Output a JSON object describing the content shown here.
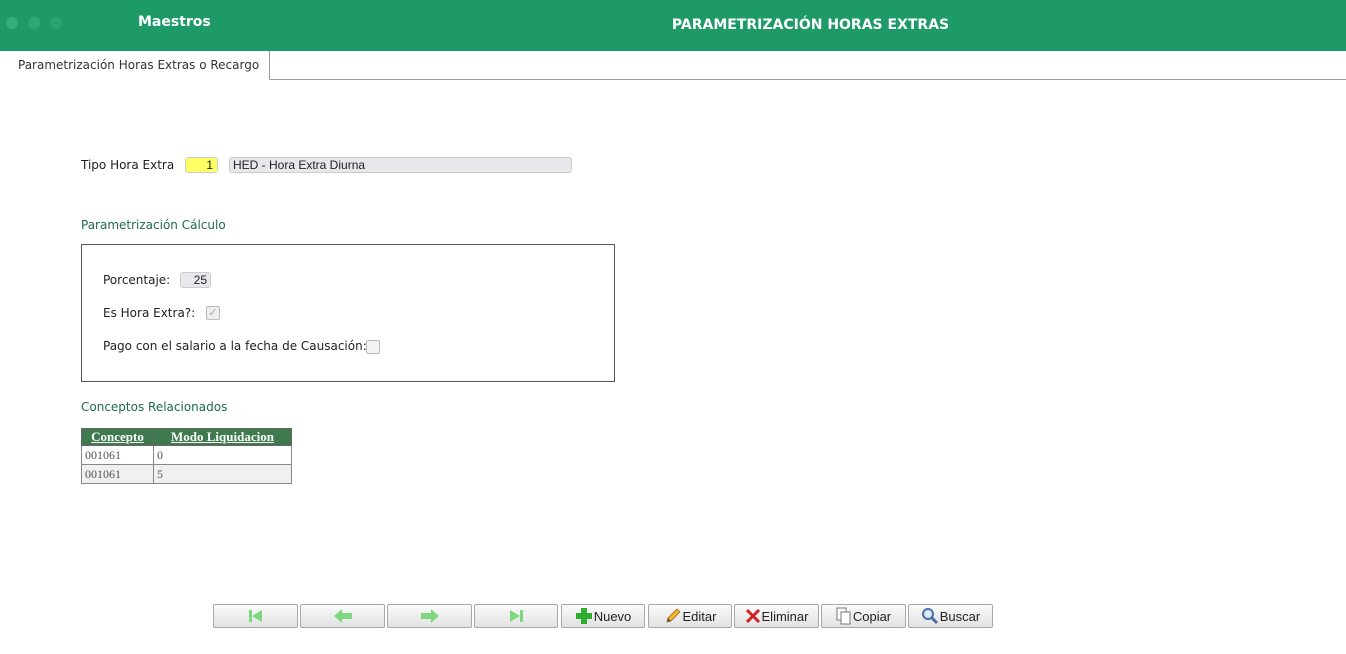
{
  "header": {
    "app_title": "Maestros",
    "window_title": "PARAMETRIZACIÓN HORAS EXTRAS",
    "brand_color": "#1e9a68"
  },
  "tabs": [
    {
      "label": "Parametrización Horas Extras o Recargo",
      "active": true
    }
  ],
  "form": {
    "tipo_label": "Tipo Hora Extra",
    "tipo_code": "1",
    "tipo_desc": "HED - Hora Extra Diurna",
    "calc_section_title": "Parametrización Cálculo",
    "porcentaje_label": "Porcentaje:",
    "porcentaje_value": "25",
    "es_hora_extra_label": "Es Hora Extra?:",
    "es_hora_extra_checked": true,
    "pago_label": "Pago con el salario a la fecha de Causación:",
    "pago_checked": false,
    "conceptos_section_title": "Conceptos Relacionados"
  },
  "grid": {
    "headers": [
      "Concepto",
      "Modo Liquidacion"
    ],
    "rows": [
      [
        "001061",
        "0"
      ],
      [
        "001061",
        "5"
      ]
    ]
  },
  "toolbar": {
    "first_icon": "first-record-icon",
    "prev_icon": "previous-record-icon",
    "next_icon": "next-record-icon",
    "last_icon": "last-record-icon",
    "nuevo": "Nuevo",
    "editar": "Editar",
    "eliminar": "Eliminar",
    "copiar": "Copiar",
    "buscar": "Buscar"
  }
}
